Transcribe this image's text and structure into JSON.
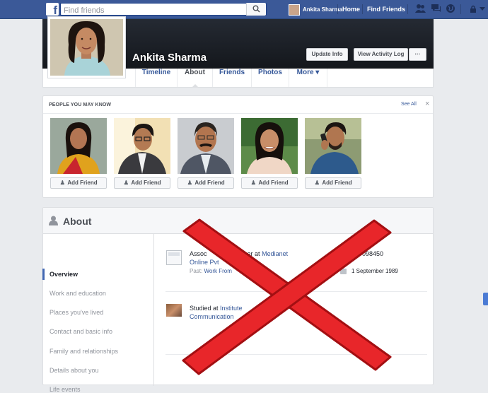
{
  "topbar": {
    "logo": "f",
    "search_placeholder": "Find friends",
    "user_name": "Ankita Sharma",
    "nav": [
      "Home",
      "Find Friends"
    ],
    "icons": [
      "friend-requests-icon",
      "messages-icon",
      "notifications-globe-icon",
      "privacy-lock-icon",
      "settings-caret-icon"
    ]
  },
  "profile": {
    "name": "Ankita Sharma",
    "update_info": "Update Info",
    "view_activity_log": "View Activity Log",
    "more_dots": "···"
  },
  "tabs": [
    "Timeline",
    "About",
    "Friends",
    "Photos",
    "More ▾"
  ],
  "pymk": {
    "title": "PEOPLE YOU MAY KNOW",
    "see_all": "See All",
    "close": "×",
    "add_label": "Add Friend",
    "people": [
      {
        "photo": "woman-saree-photo"
      },
      {
        "photo": "man-glasses-photo"
      },
      {
        "photo": "man-mustache-photo"
      },
      {
        "photo": "woman-smiling-photo"
      },
      {
        "photo": "man-phone-photo"
      }
    ]
  },
  "about": {
    "title": "About",
    "sidebar": [
      "Overview",
      "Work and education",
      "Places you've lived",
      "Contact and basic info",
      "Family and relationships",
      "Details about you",
      "Life events"
    ],
    "work_prefix": "Assoc",
    "work_mid": "roducer at",
    "work_company_a": "Medianet",
    "work_company_b": "Online Pvt",
    "work_past_label": "Past:",
    "work_past_link": "Work From",
    "phone_fragment": "098450",
    "birthday": "1 September 1989",
    "edu_prefix": "Studied at",
    "edu_link_a": "Institute",
    "edu_link_b": "Communication"
  },
  "overlay": {
    "mark": "red-x-icon",
    "color": "#e8262a",
    "stroke": "#a30f12"
  }
}
